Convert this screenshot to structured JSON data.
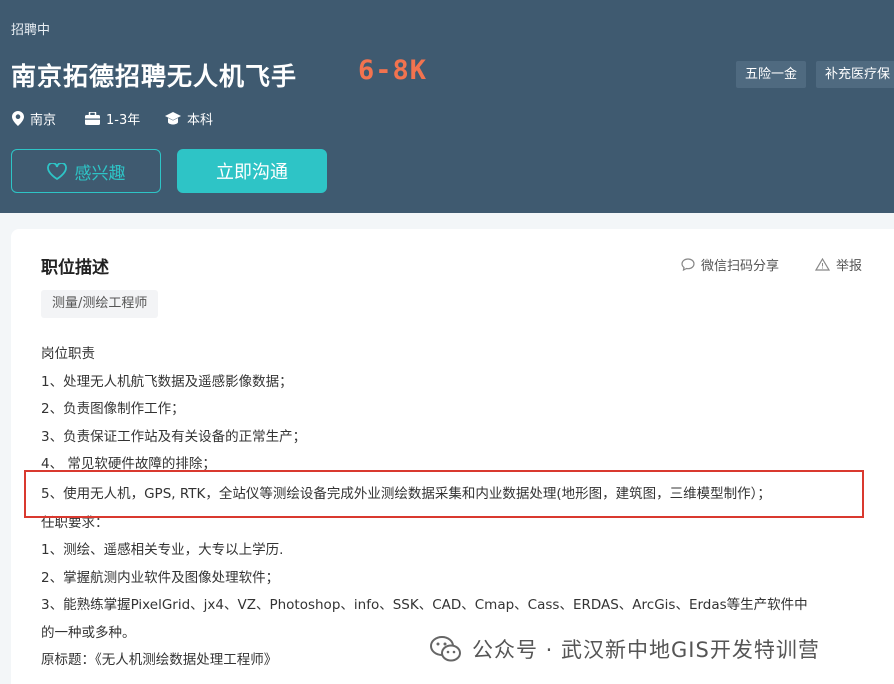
{
  "header": {
    "status": "招聘中",
    "title": "南京拓德招聘无人机飞手",
    "salary": "6-8K",
    "benefits": [
      "五险一金",
      "补充医疗保"
    ],
    "meta": {
      "location": "南京",
      "experience": "1-3年",
      "education": "本科"
    },
    "interest_button": "感兴趣",
    "chat_button": "立即沟通"
  },
  "card": {
    "section_title": "职位描述",
    "share_label": "微信扫码分享",
    "report_label": "举报",
    "tag": "测量/测绘工程师",
    "lines": [
      "岗位职责",
      "1、处理无人机航飞数据及遥感影像数据；",
      "2、负责图像制作工作；",
      "3、负责保证工作站及有关设备的正常生产；",
      "4、 常见软硬件故障的排除；",
      "5、使用无人机，GPS, RTK，全站仪等测绘设备完成外业测绘数据采集和内业数据处理(地形图，建筑图，三维模型制作）；",
      "任职要求：",
      "1、测绘、遥感相关专业，大专以上学历.",
      "2、掌握航测内业软件及图像处理软件；",
      "3、能熟练掌握PixelGrid、jx4、VZ、Photoshop、info、SSK、CAD、Cmap、Cass、ERDAS、ArcGis、Erdas等生产软件中",
      "的一种或多种。",
      "原标题：《无人机测绘数据处理工程师》"
    ]
  },
  "watermark": "公众号 · 武汉新中地GIS开发特训营",
  "colors": {
    "header_bg": "#3f5a70",
    "accent": "#2ec4c6",
    "salary": "#f2734f",
    "highlight": "#d9392f"
  }
}
